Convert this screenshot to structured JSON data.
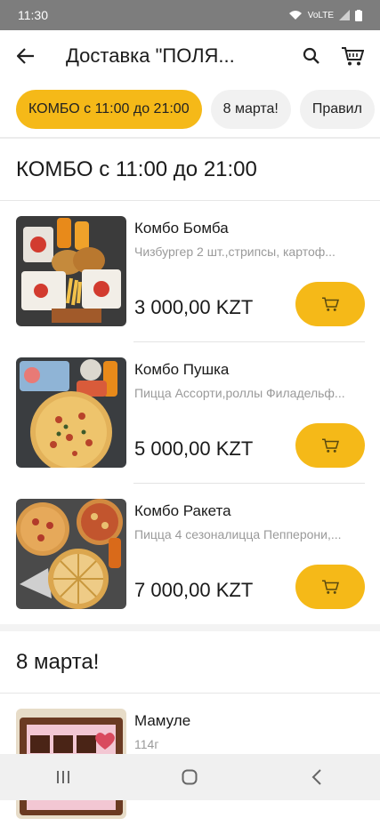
{
  "status_bar": {
    "time": "11:30",
    "network_label": "VoLTE"
  },
  "app_bar": {
    "title": "Доставка \"ПОЛЯ..."
  },
  "chips": [
    {
      "label": "КОМБО с 11:00 до 21:00",
      "active": true
    },
    {
      "label": "8 марта!",
      "active": false
    },
    {
      "label": "Правил",
      "active": false
    }
  ],
  "sections": [
    {
      "title": "КОМБО с 11:00 до 21:00"
    },
    {
      "title": "8 марта!"
    }
  ],
  "items": [
    {
      "name": "Комбо Бомба",
      "desc": "Чизбургер 2 шт.,стрипсы, картоф...",
      "price": "3 000,00 KZT",
      "image_icon": "combo-burger-photo"
    },
    {
      "name": "Комбо Пушка",
      "desc": "Пицца Ассорти,роллы Филадельф...",
      "price": "5 000,00 KZT",
      "image_icon": "combo-pizza-rolls-photo"
    },
    {
      "name": "Комбо Ракета",
      "desc": "Пицца 4 сезоналицца Пепперони,...",
      "price": "7 000,00 KZT",
      "image_icon": "combo-pizzas-photo"
    },
    {
      "name": "Мамуле",
      "desc": "114г",
      "price": "",
      "image_icon": "chocolate-box-photo"
    }
  ],
  "colors": {
    "accent": "#f5b918",
    "status_bar": "#7d7d7d"
  }
}
